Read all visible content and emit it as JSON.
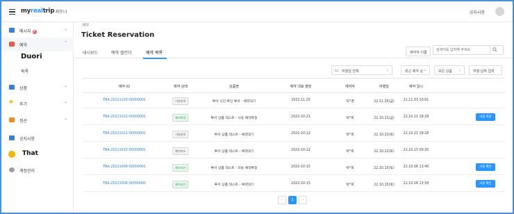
{
  "header": {
    "brand_prefix": "my",
    "brand_accent": "real",
    "brand_suffix": "trip",
    "brand_sub": "파트너",
    "notice": "공지사항"
  },
  "sidebar": {
    "items": [
      {
        "label": "메시지",
        "icon": "message-icon",
        "color": "#3b7ddd",
        "badge": "N"
      },
      {
        "label": "예약",
        "icon": "calendar-icon",
        "color": "#e8574c"
      },
      {
        "label": "상품",
        "icon": "product-icon",
        "color": "#3b7ddd"
      },
      {
        "label": "후기",
        "icon": "star-icon",
        "color": "#f4b400"
      },
      {
        "label": "정산",
        "icon": "settlement-icon",
        "color": "#f08a24"
      },
      {
        "label": "공지사항",
        "icon": "megaphone-icon",
        "color": "#3b7ddd"
      },
      {
        "label": "That",
        "icon": "smile-icon",
        "color": "#f4b400"
      },
      {
        "label": "계정관리",
        "icon": "settings-icon",
        "color": "#9e9e9e"
      }
    ],
    "sub_duori": "Duori",
    "sub_item": "목록"
  },
  "main": {
    "breadcrumb": "예약",
    "title": "Ticket Reservation",
    "tabs": [
      "대시보드",
      "예약 캘린더",
      "예약 목록"
    ],
    "search_filter_label": "예약자 이름",
    "search_placeholder": "검색어를 입력해 주세요",
    "filters": {
      "calendar": "여행일 전체",
      "sort": "최근 예약 순",
      "product": "모든 상품",
      "date": "여행 날짜 입력"
    }
  },
  "table": {
    "headers": [
      "예약 ID",
      "예약 상태",
      "상품명",
      "예약 대표 출발",
      "예약자",
      "여행일",
      "예약 일시"
    ],
    "rows": [
      {
        "id": "TNA-20221103-00000001",
        "status": "이용완료",
        "status_type": "grey",
        "product": "투어 사진 확인 투어 - 예약대기",
        "depart": "2022.11.25",
        "booker": "최*경",
        "travel_date": "22.11.25(금)",
        "booked_at": "22.11.03 10:01",
        "action": ""
      },
      {
        "id": "TNA-20221021-00000001",
        "status": "예약확정",
        "status_type": "pending",
        "product": "투어 상품 테스트 - 사용 예약확정",
        "depart": "2022-10-21",
        "booker": "박*희",
        "travel_date": "22.10.21(금)",
        "booked_at": "22.10.21 18:29",
        "action": "사용 처리"
      },
      {
        "id": "TNA-20221021-00000002",
        "status": "이용완료",
        "status_type": "grey",
        "product": "투어 상품 테스트 - 예약대기",
        "depart": "2022-10-22",
        "booker": "박*희",
        "travel_date": "22.10.22(토)",
        "booked_at": "22.10.21 18:28",
        "action": ""
      },
      {
        "id": "TNA-20221015-00000001",
        "status": "예약취소",
        "status_type": "grey",
        "product": "투어 상품 테스트 - 예약대기",
        "depart": "2022-10-22",
        "booker": "박*희",
        "travel_date": "22.10.22(토)",
        "booked_at": "22.10.15 00:30",
        "action": ""
      },
      {
        "id": "TNA-20221006-00000001",
        "status": "예약대기",
        "status_type": "pending",
        "product": "투어 상품 테스트 - 자동 예약확정",
        "depart": "2022-10-15",
        "booker": "박*희",
        "travel_date": "22.10.15(토)",
        "booked_at": "22.10.06 13:40",
        "action": "사용 확인"
      },
      {
        "id": "TNA-20221006-00000000",
        "status": "예약대기",
        "status_type": "pending",
        "product": "투어 상품 테스트 - 예약대기",
        "depart": "2022-10-15",
        "booker": "박*희",
        "travel_date": "22.10.15(토)",
        "booked_at": "22.10.06 13:39",
        "action": "사용 확인"
      }
    ]
  },
  "pagination": {
    "prev": "‹",
    "current": "1",
    "next": "›"
  }
}
